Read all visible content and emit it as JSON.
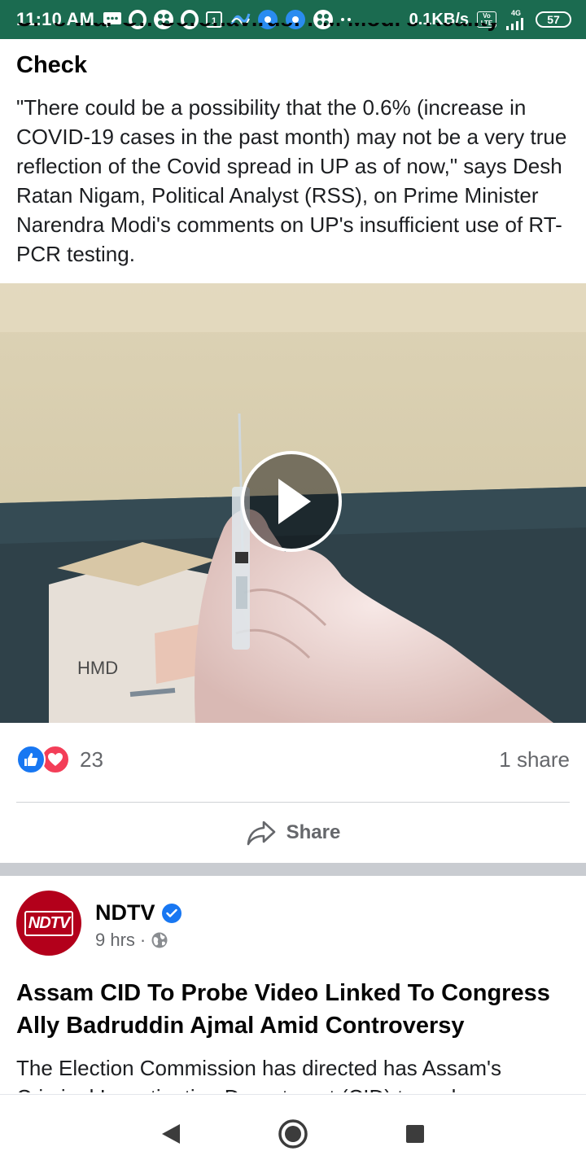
{
  "status_bar": {
    "time": "11:10 AM",
    "network_speed": "0.1KB/s",
    "volte": "Vo LTE",
    "network_type": "4G",
    "battery": "57"
  },
  "post1": {
    "clipped_title": "UP's War On Coronavirus: PM Modi's Reality",
    "title": "Check",
    "body": "\"There could be a possibility that the 0.6% (increase in COVID-19 cases in the past month) may not be a very true reflection of the Covid spread in UP as of now,\" says Desh Ratan Nigam, Political Analyst (RSS), on Prime Minister Narendra Modi's comments on UP's insufficient use of RT-PCR testing.",
    "video_box_label": "HMD",
    "reaction_count": "23",
    "share_count": "1 share",
    "share_label": "Share"
  },
  "post2": {
    "avatar_text": "NDTV",
    "page_name": "NDTV",
    "time_ago": "9 hrs",
    "meta_separator": "·",
    "headline": "Assam CID To Probe Video Linked To Congress Ally Badruddin Ajmal Amid Controversy",
    "body": "The Election Commission has directed has Assam's Criminal Investigation Department (CID) to probe a"
  },
  "colors": {
    "status_bar_bg": "#1b6b50",
    "facebook_blue": "#1877f2",
    "love_red": "#f33e58",
    "ndtv_red": "#b3001b",
    "secondary_text": "#65676b"
  }
}
